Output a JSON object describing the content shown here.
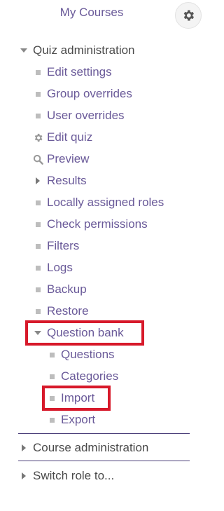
{
  "header": {
    "my_courses_label": "My Courses",
    "gear_icon": "gear-icon"
  },
  "quiz_admin": {
    "label": "Quiz administration",
    "items": [
      {
        "label": "Edit settings",
        "icon": "bullet"
      },
      {
        "label": "Group overrides",
        "icon": "bullet"
      },
      {
        "label": "User overrides",
        "icon": "bullet"
      },
      {
        "label": "Edit quiz",
        "icon": "gear-icon"
      },
      {
        "label": "Preview",
        "icon": "search-icon"
      },
      {
        "label": "Results",
        "icon": "chevron-right-icon"
      },
      {
        "label": "Locally assigned roles",
        "icon": "bullet"
      },
      {
        "label": "Check permissions",
        "icon": "bullet"
      },
      {
        "label": "Filters",
        "icon": "bullet"
      },
      {
        "label": "Logs",
        "icon": "bullet"
      },
      {
        "label": "Backup",
        "icon": "bullet"
      },
      {
        "label": "Restore",
        "icon": "bullet"
      }
    ],
    "question_bank": {
      "label": "Question bank",
      "items": [
        {
          "label": "Questions"
        },
        {
          "label": "Categories"
        },
        {
          "label": "Import"
        },
        {
          "label": "Export"
        }
      ]
    }
  },
  "course_admin": {
    "label": "Course administration"
  },
  "switch_role": {
    "label": "Switch role to..."
  },
  "colors": {
    "link": "#6a5a99",
    "text_gray": "#4a4a4a",
    "highlight": "#d7192a",
    "divider": "#4b3f7a",
    "bullet": "#bdbdbd"
  }
}
